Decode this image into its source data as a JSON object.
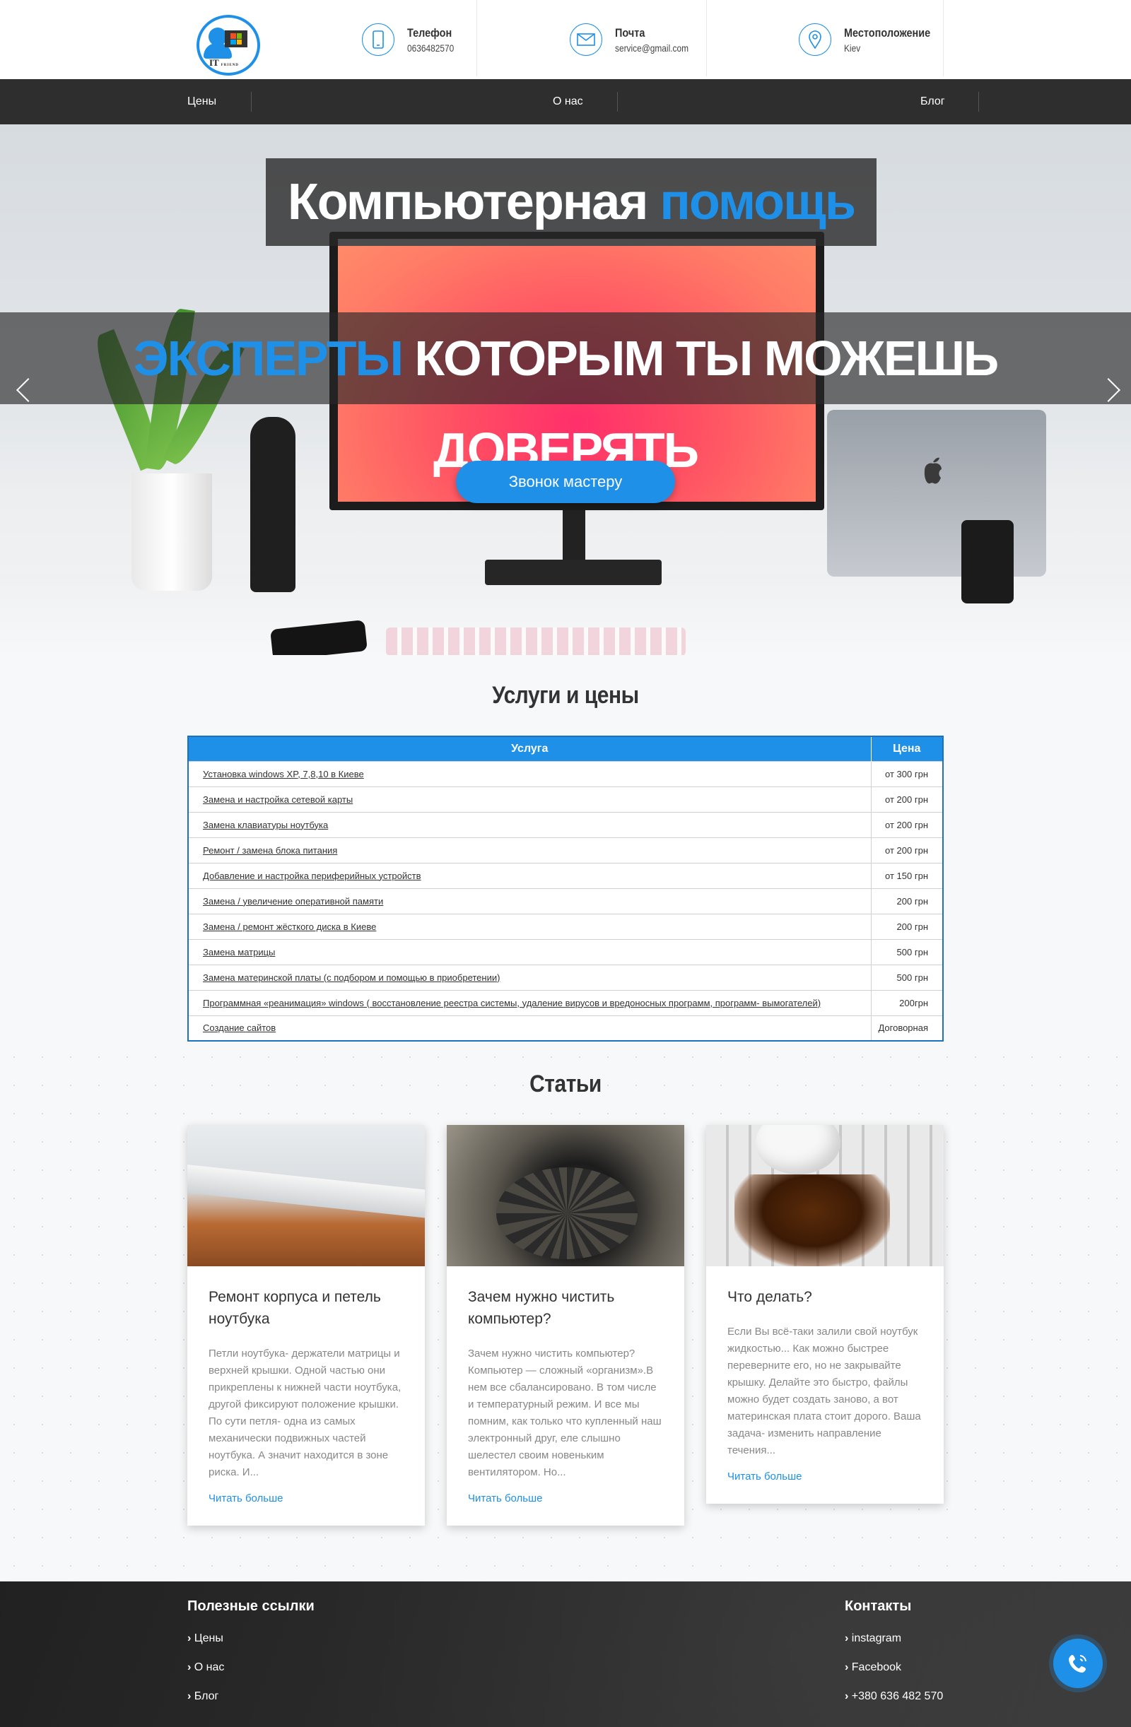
{
  "header": {
    "logo_text": "IT",
    "logo_sub": "FRIEND",
    "phone": {
      "label": "Телефон",
      "value": "0636482570",
      "icon": "phone-icon"
    },
    "email": {
      "label": "Почта",
      "value": "service@gmail.com",
      "icon": "mail-icon"
    },
    "location": {
      "label": "Местоположение",
      "value": "Kiev",
      "icon": "location-icon"
    }
  },
  "nav": {
    "items": [
      "Цены",
      "О нас",
      "Блог"
    ]
  },
  "hero": {
    "title_white": "Компьютерная ",
    "title_blue": "помощь",
    "subtitle_blue": "ЭКСПЕРТЫ",
    "subtitle_white": " КОТОРЫМ ТЫ МОЖЕШЬ ДОВЕРЯТЬ",
    "button": "Звонок мастеру"
  },
  "services": {
    "title": "Услуги и цены",
    "col_service": "Услуга",
    "col_price": "Цена",
    "rows": [
      {
        "service": "Установка windows XP, 7,8,10 в Киеве",
        "price": "от 300 грн"
      },
      {
        "service": "Замена и настройка сетевой карты",
        "price": "от 200 грн"
      },
      {
        "service": "Замена клавиатуры ноутбука",
        "price": "от 200 грн"
      },
      {
        "service": "Ремонт / замена блока питания",
        "price": "от 200 грн"
      },
      {
        "service": "Добавление и настройка периферийных устройств",
        "price": "от 150 грн"
      },
      {
        "service": "Замена / увеличение оперативной памяти",
        "price": "200 грн"
      },
      {
        "service": "Замена / ремонт жёсткого диска в Киеве",
        "price": "200 грн"
      },
      {
        "service": "Замена матрицы",
        "price": "500 грн"
      },
      {
        "service": "Замена материнской платы (с подбором и помощью в приобретении)",
        "price": "500 грн"
      },
      {
        "service": "Программная «реанимация» windows ( восстановление реестра системы, удаление вирусов и вредоносных программ, программ- вымогателей)",
        "price": "200грн"
      },
      {
        "service": "Создание сайтов",
        "price": "Договорная"
      }
    ]
  },
  "articles": {
    "title": "Статьи",
    "items": [
      {
        "title": "Ремонт корпуса и петель ноутбука",
        "text": "Петли ноутбука- держатели матрицы и верхней крышки. Одной частью они прикреплены к нижней части ноутбука, другой фиксируют положение крышки. По сути петля- одна из самых механически подвижных частей ноутбука. А значит находится в зоне риска. И...",
        "link": "Читать больше"
      },
      {
        "title": "Зачем нужно чистить компьютер?",
        "text": "Зачем нужно чистить компьютер? Компьютер — сложный «организм».В нем все сбалансировано. В том числе и температурный режим. И все мы помним, как только что купленный наш электронный друг, еле слышно шелестел своим новеньким вентилятором. Но...",
        "link": "Читать больше"
      },
      {
        "title": "Что делать?",
        "text": "Если Вы всё-таки залили свой ноутбук жидкостью... Как можно быстрее переверните его, но не закрывайте крышку. Делайте это быстро, файлы можно будет создать заново, а вот материнская плата стоит дорого. Ваша задача- изменить направление течения...",
        "link": "Читать больше"
      }
    ]
  },
  "footer": {
    "links_title": "Полезные ссылки",
    "links": [
      "Цены",
      "О нас",
      "Блог"
    ],
    "contacts_title": "Контакты",
    "contacts": [
      "instagram",
      "Facebook",
      "+380 636 482 570"
    ]
  },
  "colors": {
    "accent": "#1e90e8",
    "nav": "#2e2e2e",
    "footer": "#3a3a3a"
  }
}
